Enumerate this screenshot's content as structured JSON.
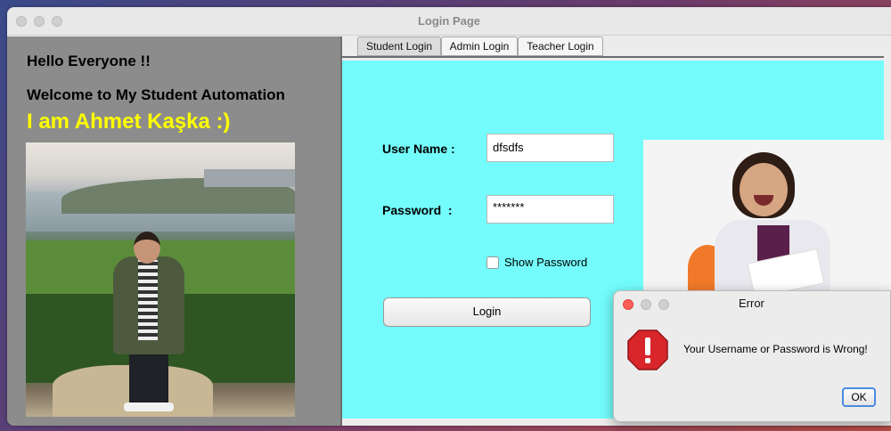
{
  "window": {
    "title": "Login Page"
  },
  "left_panel": {
    "greeting": "Hello Everyone !!",
    "welcome": "Welcome to My Student Automation",
    "name_line": "I am Ahmet Kaşka :)"
  },
  "tabs": [
    {
      "label": "Student Login",
      "active": true
    },
    {
      "label": "Admin Login",
      "active": false
    },
    {
      "label": "Teacher Login",
      "active": false
    }
  ],
  "form": {
    "username_label": "User Name :",
    "username_value": "dfsdfs",
    "password_label": "Password  :",
    "password_value": "*******",
    "show_password_label": "Show Password",
    "show_password_checked": false,
    "login_button": "Login"
  },
  "dialog": {
    "title": "Error",
    "message": "Your Username or Password is Wrong!",
    "ok_button": "OK",
    "icon": "stop-icon"
  },
  "colors": {
    "content_bg": "#73fcfb",
    "left_bg": "#8c8c8c",
    "name_color": "#ffff00",
    "ok_border": "#4a8ae0",
    "stop_icon": "#d9262b"
  }
}
